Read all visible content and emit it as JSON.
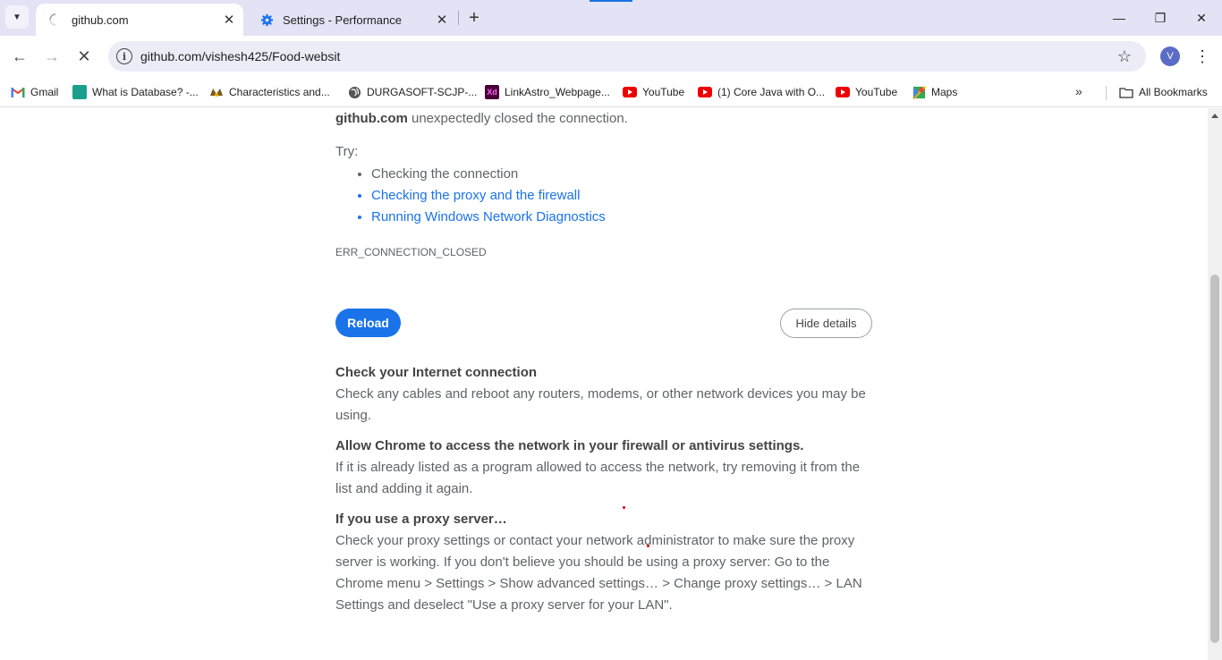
{
  "tabs": [
    {
      "title": "github.com",
      "active": true,
      "icon": "loading-spinner-icon"
    },
    {
      "title": "Settings - Performance",
      "active": false,
      "icon": "gear-icon"
    }
  ],
  "window": {
    "minimize": "—",
    "restore": "❐",
    "close": "✕"
  },
  "toolbar": {
    "url": "github.com/vishesh425/Food-websit",
    "avatar_letter": "V"
  },
  "bookmarks": [
    {
      "label": "Gmail",
      "icon": "gmail-icon"
    },
    {
      "label": "What is Database? -...",
      "icon": "database-site-icon"
    },
    {
      "label": "Characteristics and...",
      "icon": "characteristics-site-icon"
    },
    {
      "label": "DURGASOFT-SCJP-...",
      "icon": "globe-icon"
    },
    {
      "label": "LinkAstro_Webpage...",
      "icon": "adobe-xd-icon"
    },
    {
      "label": "YouTube",
      "icon": "youtube-icon"
    },
    {
      "label": "(1) Core Java with O...",
      "icon": "youtube-icon"
    },
    {
      "label": "YouTube",
      "icon": "youtube-icon"
    },
    {
      "label": "Maps",
      "icon": "maps-icon"
    }
  ],
  "all_bookmarks": "All Bookmarks",
  "error": {
    "host": "github.com",
    "message": " unexpectedly closed the connection.",
    "try_label": "Try:",
    "suggestions": [
      {
        "text": "Checking the connection",
        "link": false
      },
      {
        "text": "Checking the proxy and the firewall",
        "link": true
      },
      {
        "text": "Running Windows Network Diagnostics",
        "link": true
      }
    ],
    "code": "ERR_CONNECTION_CLOSED",
    "reload": "Reload",
    "hide_details": "Hide details"
  },
  "details": [
    {
      "heading": "Check your Internet connection",
      "body": "Check any cables and reboot any routers, modems, or other network devices you may be using."
    },
    {
      "heading": "Allow Chrome to access the network in your firewall or antivirus settings.",
      "body": "If it is already listed as a program allowed to access the network, try removing it from the list and adding it again."
    },
    {
      "heading": "If you use a proxy server…",
      "body": "Check your proxy settings or contact your network administrator to make sure the proxy server is working. If you don't believe you should be using a proxy server: Go to the Chrome menu > Settings > Show advanced settings… > Change proxy settings… > LAN Settings and deselect \"Use a proxy server for your LAN\"."
    }
  ],
  "colors": {
    "accent": "#1a73e8",
    "tabstrip": "#e3e3f5",
    "text": "#5f6368"
  }
}
